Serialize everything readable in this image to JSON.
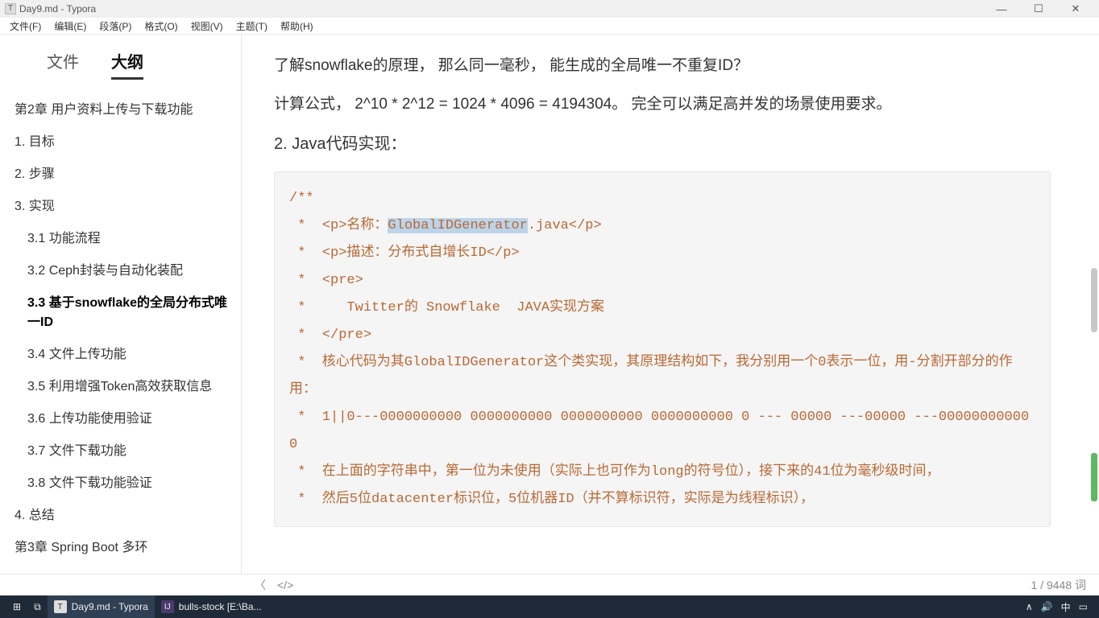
{
  "titlebar": {
    "icon": "T",
    "title": "Day9.md - Typora"
  },
  "menubar": [
    "文件(F)",
    "编辑(E)",
    "段落(P)",
    "格式(O)",
    "视图(V)",
    "主题(T)",
    "帮助(H)"
  ],
  "sidebar": {
    "tabs": {
      "files": "文件",
      "outline": "大纲"
    },
    "items": [
      {
        "text": "第2章 用户资料上传与下载功能",
        "lvl": 1
      },
      {
        "text": "1. 目标",
        "lvl": 1
      },
      {
        "text": "2. 步骤",
        "lvl": 1
      },
      {
        "text": "3. 实现",
        "lvl": 1
      },
      {
        "text": "3.1 功能流程",
        "lvl": 2
      },
      {
        "text": "3.2 Ceph封装与自动化装配",
        "lvl": 2
      },
      {
        "text": "3.3 基于snowflake的全局分布式唯一ID",
        "lvl": 2,
        "active": true
      },
      {
        "text": "3.4 文件上传功能",
        "lvl": 2
      },
      {
        "text": "3.5 利用增强Token高效获取信息",
        "lvl": 2
      },
      {
        "text": "3.6 上传功能使用验证",
        "lvl": 2
      },
      {
        "text": "3.7 文件下载功能",
        "lvl": 2
      },
      {
        "text": "3.8 文件下载功能验证",
        "lvl": 2
      },
      {
        "text": "4. 总结",
        "lvl": 1
      },
      {
        "text": "第3章 Spring Boot 多环",
        "lvl": 1
      }
    ]
  },
  "content": {
    "p1": "了解snowflake的原理， 那么同一毫秒， 能生成的全局唯一不重复ID？",
    "p2": "计算公式， 2^10 * 2^12 = 1024 * 4096 = 4194304。 完全可以满足高并发的场景使用要求。",
    "h2": "2. Java代码实现：",
    "code": {
      "l1": "/**",
      "l2a": " *  <p>名称：",
      "l2sel": "GlobalIDGenerator",
      "l2b": ".java</p>",
      "l3": " *  <p>描述：分布式自增长ID</p>",
      "l4": " *  <pre>",
      "l5": " *     Twitter的 Snowflake  JAVA实现方案",
      "l6": " *  </pre>",
      "l7": " *  核心代码为其GlobalIDGenerator这个类实现，其原理结构如下，我分别用一个0表示一位，用-分割开部分的作用：",
      "l8": " *  1||0---0000000000 0000000000 0000000000 0000000000 0 --- 00000 ---00000 ---000000000000",
      "l9": " *  在上面的字符串中，第一位为未使用（实际上也可作为long的符号位），接下来的41位为毫秒级时间，",
      "l10": " *  然后5位datacenter标识位，5位机器ID（并不算标识符，实际是为线程标识），"
    }
  },
  "statusbar": {
    "back": "〈",
    "code_icon": "</>",
    "pos": "1 / 9448 词"
  },
  "taskbar": {
    "items": [
      {
        "icon": "T",
        "label": "Day9.md - Typora",
        "active": true
      },
      {
        "icon": "IJ",
        "label": "bulls-stock [E:\\Ba...",
        "active": false
      }
    ],
    "tray": {
      "up": "∧",
      "vol": "🔊",
      "ime": "中",
      "notif": "▭"
    }
  }
}
